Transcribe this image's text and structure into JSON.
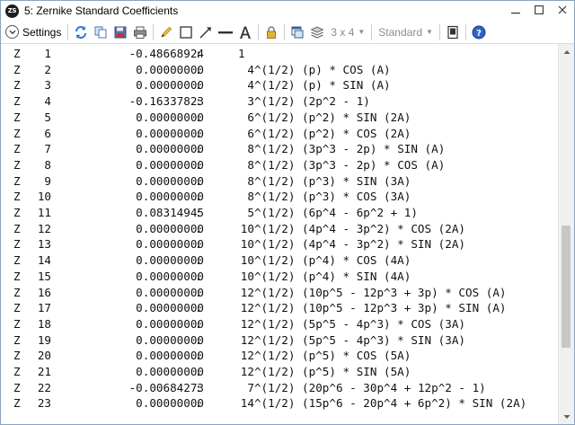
{
  "window": {
    "app_badge": "ZS",
    "title": "5: Zernike Standard Coefficients"
  },
  "toolbar": {
    "settings_label": "Settings",
    "layout_value": "3 x 4",
    "style_value": "Standard",
    "icons": [
      "refresh-icon",
      "copy-icon",
      "save-icon",
      "print-icon",
      "pencil-icon",
      "rectangle-icon",
      "arrow-icon",
      "line-icon",
      "text-icon",
      "lock-icon",
      "window-icon",
      "layers-icon",
      "view-icon",
      "help-icon"
    ]
  },
  "rows": [
    {
      "z": "Z",
      "n": "1",
      "value": "-0.48668924",
      "sep": ":",
      "formula": "1"
    },
    {
      "z": "Z",
      "n": "2",
      "value": "0.00000000",
      "sep": ":",
      "formula": "4^(1/2) (p) * COS (A)"
    },
    {
      "z": "Z",
      "n": "3",
      "value": "0.00000000",
      "sep": ":",
      "formula": "4^(1/2) (p) * SIN (A)"
    },
    {
      "z": "Z",
      "n": "4",
      "value": "-0.16337823",
      "sep": ":",
      "formula": "3^(1/2) (2p^2 - 1)"
    },
    {
      "z": "Z",
      "n": "5",
      "value": "0.00000000",
      "sep": ":",
      "formula": "6^(1/2) (p^2) * SIN (2A)"
    },
    {
      "z": "Z",
      "n": "6",
      "value": "0.00000000",
      "sep": ":",
      "formula": "6^(1/2) (p^2) * COS (2A)"
    },
    {
      "z": "Z",
      "n": "7",
      "value": "0.00000000",
      "sep": ":",
      "formula": "8^(1/2) (3p^3 - 2p) * SIN (A)"
    },
    {
      "z": "Z",
      "n": "8",
      "value": "0.00000000",
      "sep": ":",
      "formula": "8^(1/2) (3p^3 - 2p) * COS (A)"
    },
    {
      "z": "Z",
      "n": "9",
      "value": "0.00000000",
      "sep": ":",
      "formula": "8^(1/2) (p^3) * SIN (3A)"
    },
    {
      "z": "Z",
      "n": "10",
      "value": "0.00000000",
      "sep": ":",
      "formula": "8^(1/2) (p^3) * COS (3A)"
    },
    {
      "z": "Z",
      "n": "11",
      "value": "0.08314945",
      "sep": ":",
      "formula": "5^(1/2) (6p^4 - 6p^2 + 1)"
    },
    {
      "z": "Z",
      "n": "12",
      "value": "0.00000000",
      "sep": ":",
      "formula": "10^(1/2) (4p^4 - 3p^2) * COS (2A)"
    },
    {
      "z": "Z",
      "n": "13",
      "value": "0.00000000",
      "sep": ":",
      "formula": "10^(1/2) (4p^4 - 3p^2) * SIN (2A)"
    },
    {
      "z": "Z",
      "n": "14",
      "value": "0.00000000",
      "sep": ":",
      "formula": "10^(1/2) (p^4) * COS (4A)"
    },
    {
      "z": "Z",
      "n": "15",
      "value": "0.00000000",
      "sep": ":",
      "formula": "10^(1/2) (p^4) * SIN (4A)"
    },
    {
      "z": "Z",
      "n": "16",
      "value": "0.00000000",
      "sep": ":",
      "formula": "12^(1/2) (10p^5 - 12p^3 + 3p) * COS (A)"
    },
    {
      "z": "Z",
      "n": "17",
      "value": "0.00000000",
      "sep": ":",
      "formula": "12^(1/2) (10p^5 - 12p^3 + 3p) * SIN (A)"
    },
    {
      "z": "Z",
      "n": "18",
      "value": "0.00000000",
      "sep": ":",
      "formula": "12^(1/2) (5p^5 - 4p^3) * COS (3A)"
    },
    {
      "z": "Z",
      "n": "19",
      "value": "0.00000000",
      "sep": ":",
      "formula": "12^(1/2) (5p^5 - 4p^3) * SIN (3A)"
    },
    {
      "z": "Z",
      "n": "20",
      "value": "0.00000000",
      "sep": ":",
      "formula": "12^(1/2) (p^5) * COS (5A)"
    },
    {
      "z": "Z",
      "n": "21",
      "value": "0.00000000",
      "sep": ":",
      "formula": "12^(1/2) (p^5) * SIN (5A)"
    },
    {
      "z": "Z",
      "n": "22",
      "value": "-0.00684273",
      "sep": ":",
      "formula": "7^(1/2) (20p^6 - 30p^4 + 12p^2 - 1)"
    },
    {
      "z": "Z",
      "n": "23",
      "value": "0.00000000",
      "sep": ":",
      "formula": "14^(1/2) (15p^6 - 20p^4 + 6p^2) * SIN (2A)"
    }
  ]
}
